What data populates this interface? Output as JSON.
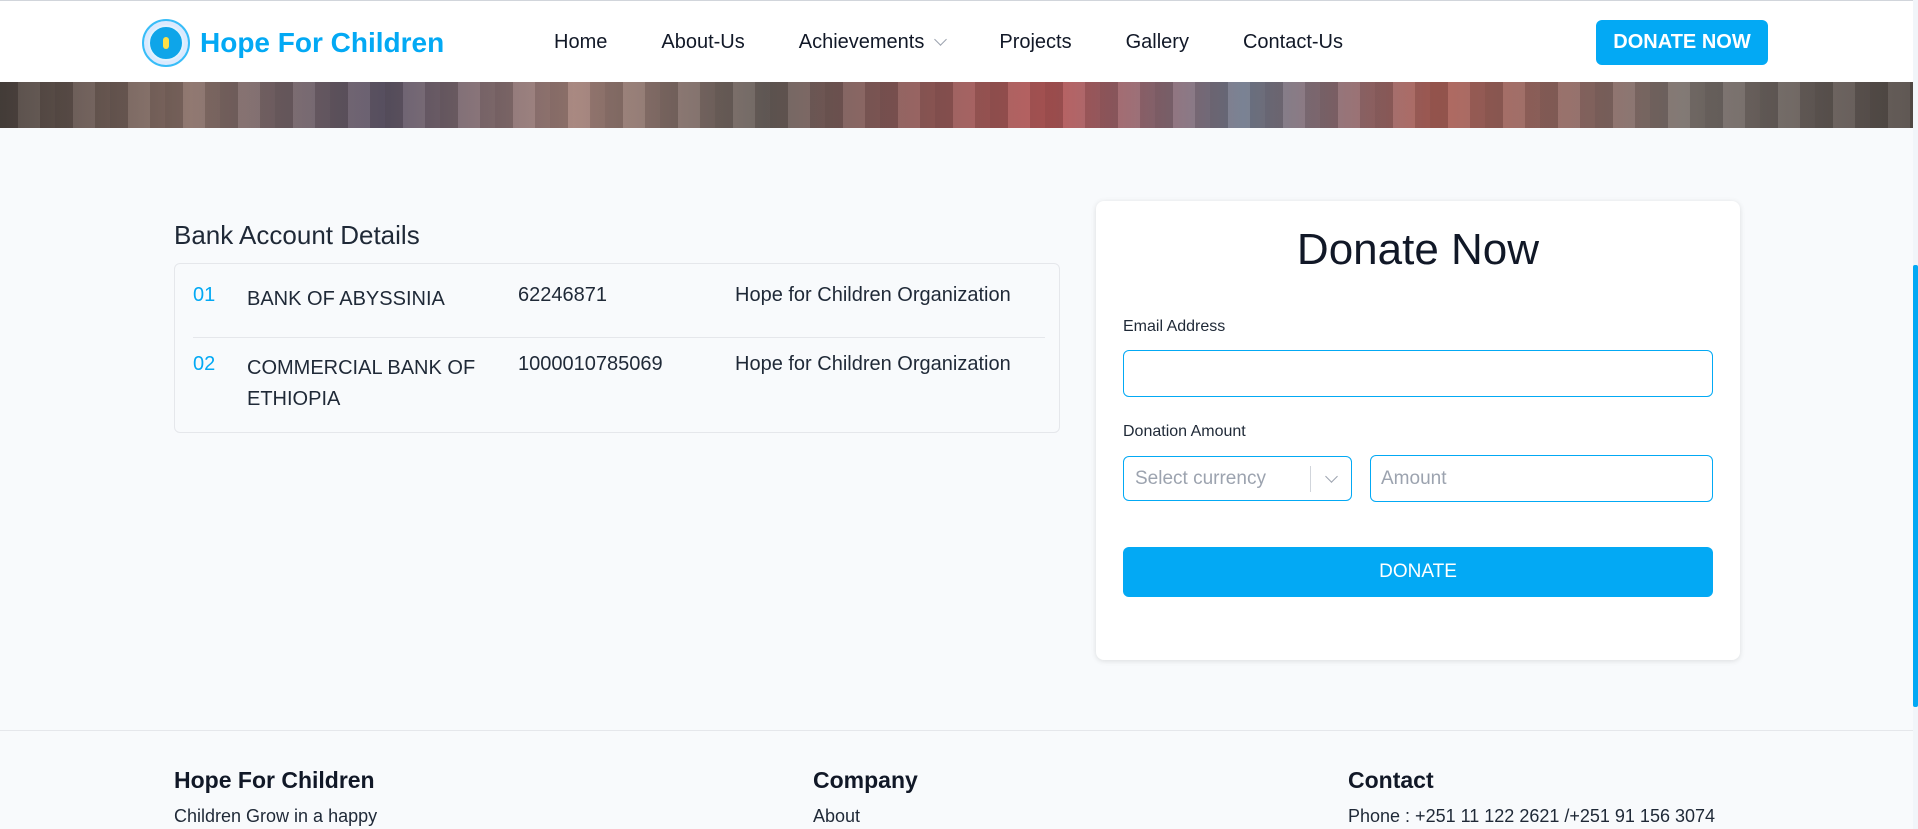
{
  "header": {
    "brand": "Hope For Children",
    "nav": [
      {
        "label": "Home"
      },
      {
        "label": "About-Us"
      },
      {
        "label": "Achievements",
        "has_dropdown": true
      },
      {
        "label": "Projects"
      },
      {
        "label": "Gallery"
      },
      {
        "label": "Contact-Us"
      }
    ],
    "donate_button": "DONATE NOW"
  },
  "bank": {
    "title": "Bank Account Details",
    "rows": [
      {
        "num": "01",
        "bank": "BANK OF ABYSSINIA",
        "account": "62246871",
        "holder": "Hope for Children Organization"
      },
      {
        "num": "02",
        "bank": "COMMERCIAL BANK OF ETHIOPIA",
        "account": "1000010785069",
        "holder": "Hope for Children Organization"
      }
    ]
  },
  "donate_form": {
    "title": "Donate Now",
    "email_label": "Email Address",
    "email_value": "",
    "amount_label": "Donation Amount",
    "currency_placeholder": "Select currency",
    "amount_placeholder": "Amount",
    "submit_label": "DONATE"
  },
  "footer": {
    "about": {
      "title": "Hope For Children",
      "text": "Children Grow in a happy"
    },
    "company": {
      "title": "Company",
      "link": "About"
    },
    "contact": {
      "title": "Contact",
      "phone": "Phone : +251 11 122 2621 /+251 91 156 3074"
    }
  },
  "colors": {
    "accent": "#03a9f4",
    "background": "#f8fafc"
  }
}
